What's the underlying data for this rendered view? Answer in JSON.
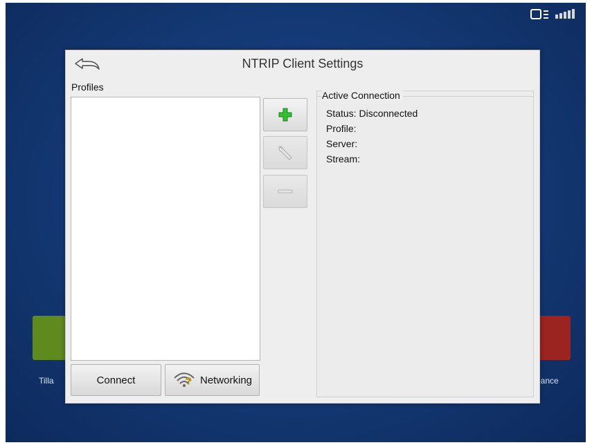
{
  "dialog": {
    "title": "NTRIP Client Settings",
    "back_icon": "back-arrow-icon"
  },
  "profiles": {
    "label": "Profiles",
    "items": []
  },
  "side_buttons": {
    "add_icon": "plus-icon",
    "edit_icon": "wrench-icon",
    "remove_icon": "minus-icon"
  },
  "bottom_buttons": {
    "connect_label": "Connect",
    "networking_label": "Networking",
    "networking_icon": "wifi-question-icon"
  },
  "active_connection": {
    "title": "Active Connection",
    "status": "Status: Disconnected",
    "profile": "Profile:",
    "server": "Server:",
    "stream": "Stream:"
  },
  "background": {
    "tillage_label": "Tilla",
    "guidance_label": "lance"
  },
  "colors": {
    "accent_add": "#2fb52f",
    "screen_blue": "#153b78",
    "tillage_green": "#5f8a1e",
    "guidance_red": "#9b2320"
  }
}
